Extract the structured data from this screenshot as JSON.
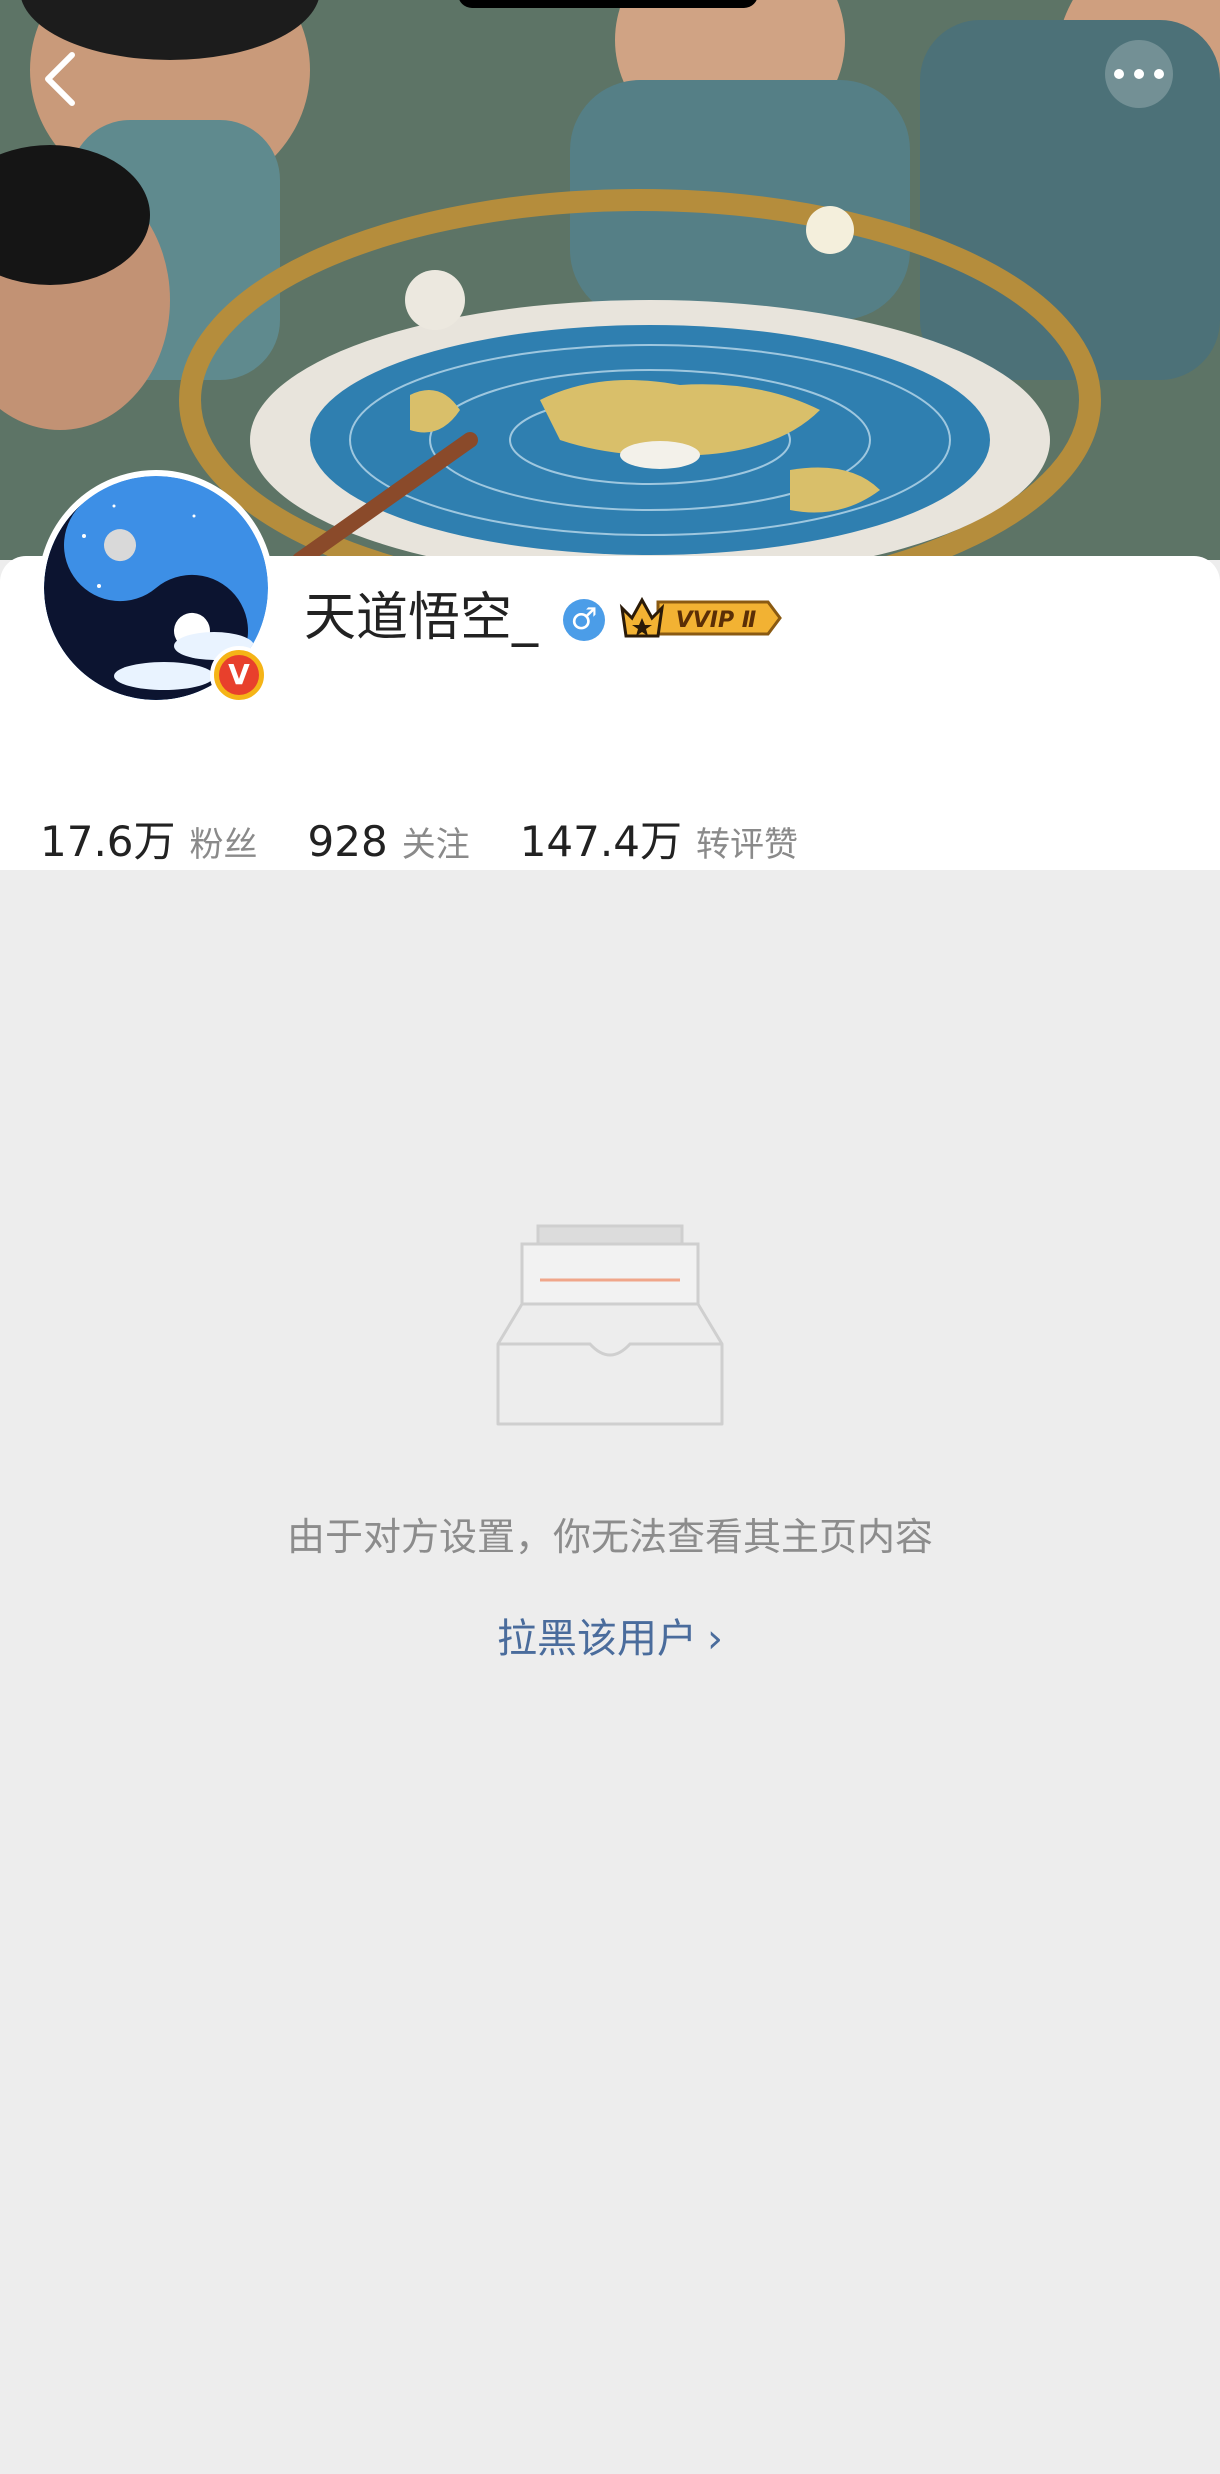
{
  "profile": {
    "username": "天道悟空_",
    "gender_symbol": "♂",
    "vip_label": "VVIP Ⅱ",
    "verified_mark": "V"
  },
  "stats": [
    {
      "value": "17.6万",
      "label": "粉丝"
    },
    {
      "value": "928",
      "label": "关注"
    },
    {
      "value": "147.4万",
      "label": "转评赞"
    }
  ],
  "empty_state": {
    "message": "由于对方设置，你无法查看其主页内容",
    "block_link": "拉黑该用户",
    "block_chevron": "›"
  },
  "icons": {
    "back": "chevron-left-icon",
    "more": "more-dots-icon",
    "gender": "male-icon",
    "vip": "vip-crown-icon",
    "verified": "verified-icon",
    "empty": "empty-inbox-icon"
  },
  "colors": {
    "background": "#ededed",
    "card": "#ffffff",
    "link": "#4a6c9c",
    "muted_text": "#8a8a8a",
    "gender_blue": "#4b9de8",
    "vip_gold": "#f2b233",
    "verified_orange": "#e8402c"
  }
}
